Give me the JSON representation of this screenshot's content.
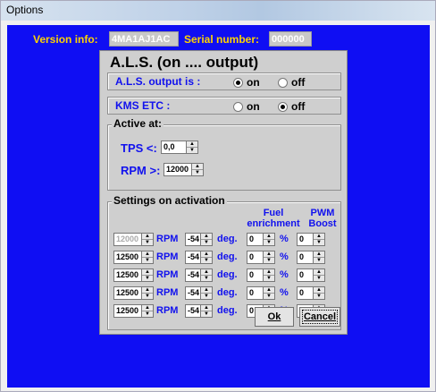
{
  "window": {
    "title": "Options"
  },
  "version": {
    "label": "Version info:",
    "value": "4MA1AJ1AC",
    "serial_label": "Serial number:",
    "serial_value": "000000"
  },
  "panel": {
    "title": "A.L.S. (on .... output)"
  },
  "als_output": {
    "label": "A.L.S. output is :",
    "on": "on",
    "off": "off",
    "selected": "on"
  },
  "kms_etc": {
    "label": "KMS ETC :",
    "on": "on",
    "off": "off",
    "selected": "off"
  },
  "active_at": {
    "legend": "Active at:",
    "tps_label": "TPS <:",
    "tps_value": "0,0",
    "rpm_label": "RPM >:",
    "rpm_value": "12000"
  },
  "settings": {
    "legend": "Settings on activation",
    "fuel_header_1": "Fuel",
    "fuel_header_2": "enrichment",
    "pwm_header_1": "PWM",
    "pwm_header_2": "Boost",
    "rpm_unit": "RPM",
    "deg_unit": "deg.",
    "pct_unit": "%",
    "rows": [
      {
        "rpm": "12000",
        "deg": "-54",
        "fuel": "0",
        "pwm": "0"
      },
      {
        "rpm": "12500",
        "deg": "-54",
        "fuel": "0",
        "pwm": "0"
      },
      {
        "rpm": "12500",
        "deg": "-54",
        "fuel": "0",
        "pwm": "0"
      },
      {
        "rpm": "12500",
        "deg": "-54",
        "fuel": "0",
        "pwm": "0"
      },
      {
        "rpm": "12500",
        "deg": "-54",
        "fuel": "0",
        "pwm": "0"
      }
    ]
  },
  "buttons": {
    "ok": "Ok",
    "cancel": "Cancel"
  },
  "icons": {
    "spin_up": "spin-up-icon",
    "spin_down": "spin-down-icon"
  },
  "colors": {
    "background": "#0f0ef3",
    "label_yellow": "#ffd400",
    "label_blue": "#1111ee",
    "panel": "#cfcfcf"
  }
}
